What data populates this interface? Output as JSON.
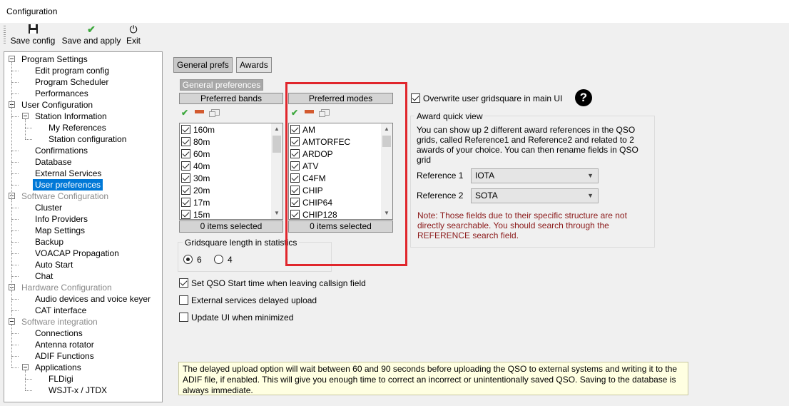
{
  "window": {
    "title": "Configuration"
  },
  "toolbar": {
    "save_config": "Save config",
    "save_apply": "Save and apply",
    "exit": "Exit"
  },
  "tree": [
    {
      "label": "Program Settings",
      "level": 0,
      "gray": false
    },
    {
      "label": "Edit program config",
      "level": 1
    },
    {
      "label": "Program Scheduler",
      "level": 1
    },
    {
      "label": "Performances",
      "level": 1
    },
    {
      "label": "User Configuration",
      "level": 0
    },
    {
      "label": "Station Information",
      "level": 1
    },
    {
      "label": "My References",
      "level": 2
    },
    {
      "label": "Station configuration",
      "level": 2
    },
    {
      "label": "Confirmations",
      "level": 1
    },
    {
      "label": "Database",
      "level": 1
    },
    {
      "label": "External Services",
      "level": 1
    },
    {
      "label": "User preferences",
      "level": 1,
      "selected": true
    },
    {
      "label": "Software Configuration",
      "level": 0,
      "gray": true
    },
    {
      "label": "Cluster",
      "level": 1
    },
    {
      "label": "Info Providers",
      "level": 1
    },
    {
      "label": "Map Settings",
      "level": 1
    },
    {
      "label": "Backup",
      "level": 1
    },
    {
      "label": "VOACAP Propagation",
      "level": 1
    },
    {
      "label": "Auto Start",
      "level": 1
    },
    {
      "label": "Chat",
      "level": 1
    },
    {
      "label": "Hardware Configuration",
      "level": 0,
      "gray": true
    },
    {
      "label": "Audio devices and voice keyer",
      "level": 1
    },
    {
      "label": "CAT interface",
      "level": 1
    },
    {
      "label": "Software integration",
      "level": 0,
      "gray": true
    },
    {
      "label": "Connections",
      "level": 1
    },
    {
      "label": "Antenna rotator",
      "level": 1
    },
    {
      "label": "ADIF Functions",
      "level": 1
    },
    {
      "label": "Applications",
      "level": 1
    },
    {
      "label": "FLDigi",
      "level": 2
    },
    {
      "label": "WSJT-x / JTDX",
      "level": 2
    }
  ],
  "tabs": {
    "general": "General prefs",
    "awards": "Awards"
  },
  "general_prefs_label": "General preferences",
  "bands": {
    "header": "Preferred bands",
    "items": [
      "160m",
      "80m",
      "60m",
      "40m",
      "30m",
      "20m",
      "17m",
      "15m"
    ],
    "status": "0 items selected"
  },
  "modes": {
    "header": "Preferred modes",
    "items": [
      "AM",
      "AMTORFEC",
      "ARDOP",
      "ATV",
      "C4FM",
      "CHIP",
      "CHIP64",
      "CHIP128"
    ],
    "status": "0 items selected"
  },
  "gridsquare": {
    "label": "Gridsquare length in statistics",
    "opt1": "6",
    "opt2": "4"
  },
  "options": {
    "set_qso_start": "Set QSO Start time when leaving callsign field",
    "ext_delayed": "External services delayed upload",
    "update_minimized": "Update UI when minimized",
    "overwrite_grid": "Overwrite user gridsquare in main UI"
  },
  "award": {
    "group_label": "Award quick view",
    "description": "You can show up 2 different award references in the QSO grids, called Reference1 and Reference2 and related to 2 awards of your choice. You can then rename fields in QSO grid",
    "ref1_label": "Reference 1",
    "ref1_value": "IOTA",
    "ref2_label": "Reference 2",
    "ref2_value": "SOTA",
    "note": "Note: Those fields due to their specific structure are not directly searchable. You should search through the REFERENCE search field."
  },
  "info": "The delayed upload option will wait between 60 and 90 seconds before uploading the QSO to external systems and writing it to the ADIF file, if enabled. This will give you enough time to correct an incorrect or unintentionally saved QSO. Saving to the database is always immediate."
}
